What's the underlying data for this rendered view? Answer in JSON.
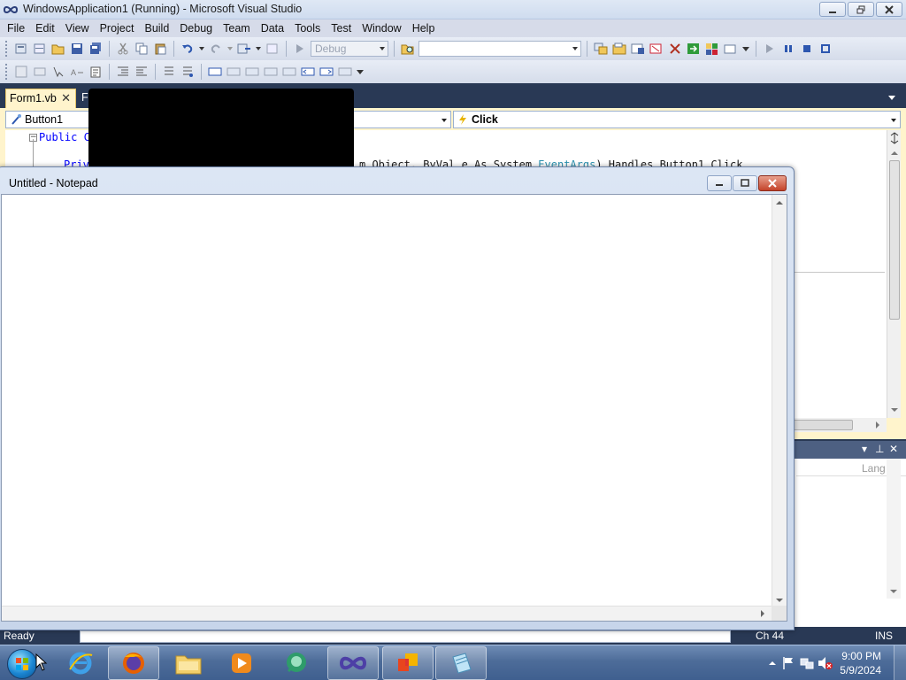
{
  "vs": {
    "title": "WindowsApplication1 (Running) - Microsoft Visual Studio",
    "menu": [
      "File",
      "Edit",
      "View",
      "Project",
      "Build",
      "Debug",
      "Team",
      "Data",
      "Tools",
      "Test",
      "Window",
      "Help"
    ],
    "config_combo": "Debug",
    "platform_combo": "",
    "doc_tabs": [
      {
        "label": "Form1.vb",
        "active": true
      },
      {
        "label": "Fo",
        "active": false
      }
    ],
    "nav_object": "Button1",
    "nav_event": "Click",
    "code": {
      "line1_kw": "Public",
      "line1_rest": "C",
      "line2_prefix": "Priv",
      "line2_obj_kw": "m Object, ByVal e As System.",
      "line2_type": "EventArgs",
      "line2_tail": ") Handles Button1.Click"
    },
    "tool_column_header": "Lang",
    "status": {
      "ready": "Ready",
      "ch": "Ch 44",
      "ins": "INS"
    }
  },
  "notepad": {
    "title": "Untitled - Notepad",
    "text": ""
  },
  "taskbar": {
    "apps": [
      "Internet Explorer",
      "Firefox",
      "Windows Explorer",
      "Windows Media Player",
      "Chat",
      "Visual Studio",
      "Office",
      "Notepad"
    ],
    "time": "9:00 PM",
    "date": "5/9/2024"
  },
  "colors": {
    "vs_chrome": "#293955",
    "tab_active": "#fff4cc",
    "taskbar": "#4d6c99"
  }
}
